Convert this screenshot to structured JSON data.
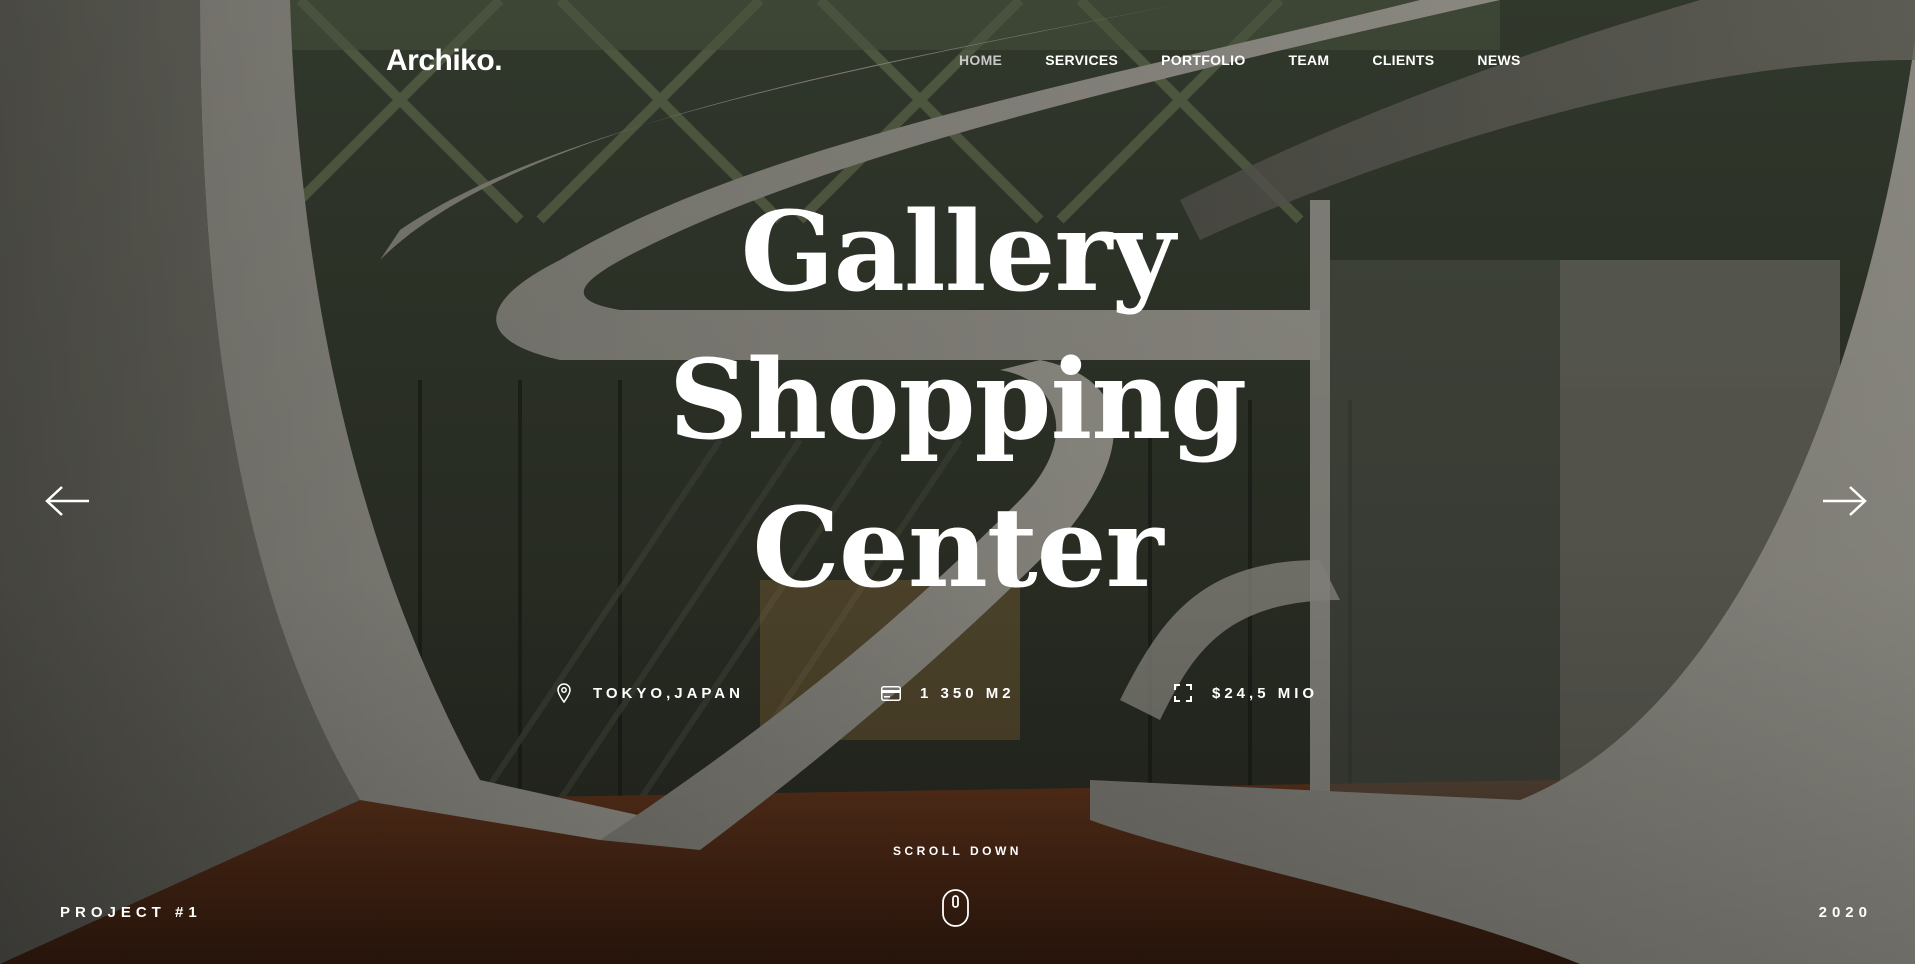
{
  "header": {
    "logo": "Archiko.",
    "nav": [
      {
        "label": "HOME",
        "active": true
      },
      {
        "label": "SERVICES"
      },
      {
        "label": "PORTFOLIO"
      },
      {
        "label": "TEAM"
      },
      {
        "label": "CLIENTS"
      },
      {
        "label": "NEWS"
      }
    ]
  },
  "hero": {
    "title_lines": [
      "Gallery",
      "Shopping",
      "Center"
    ],
    "stats": {
      "location": {
        "icon": "map-pin-icon",
        "value": "TOKYO,JAPAN"
      },
      "area": {
        "icon": "card-icon",
        "value": "1 350 M2"
      },
      "price": {
        "icon": "expand-icon",
        "value": "$24,5 MIO"
      }
    },
    "prev_icon": "arrow-left-icon",
    "next_icon": "arrow-right-icon"
  },
  "scroll": {
    "label": "SCROLL DOWN",
    "icon": "mouse-icon"
  },
  "footer": {
    "project": "PROJECT #1",
    "year": "2020"
  },
  "colors": {
    "text": "#ffffff",
    "nav_active": "#c9c9c9"
  }
}
